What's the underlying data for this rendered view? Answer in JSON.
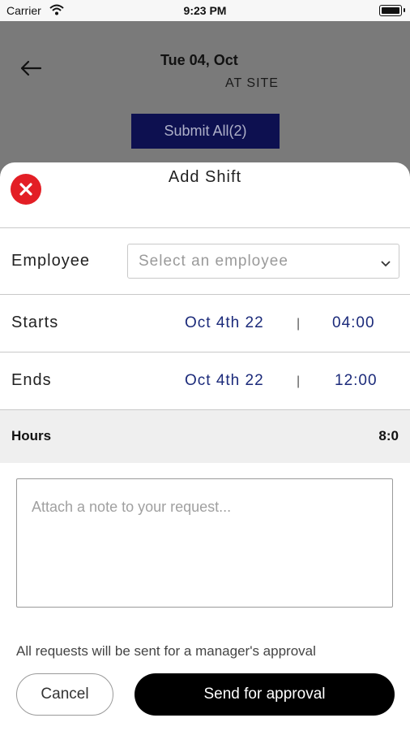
{
  "status_bar": {
    "carrier": "Carrier",
    "time": "9:23 PM"
  },
  "header": {
    "date_title": "Tue 04, Oct",
    "site_label": "AT SITE",
    "submit_all_label": "Submit All(2)"
  },
  "sheet": {
    "title": "Add Shift",
    "employee": {
      "label": "Employee",
      "placeholder": "Select an employee"
    },
    "starts": {
      "label": "Starts",
      "date": "Oct 4th 22",
      "separator": "|",
      "time": "04:00"
    },
    "ends": {
      "label": "Ends",
      "date": "Oct 4th 22",
      "separator": "|",
      "time": "12:00"
    },
    "hours": {
      "label": "Hours",
      "value": "8:0"
    },
    "note_placeholder": "Attach a note to your request...",
    "approval_note": "All requests will be sent for a manager's approval",
    "cancel_label": "Cancel",
    "send_label": "Send for approval"
  },
  "colors": {
    "submit_bg": "#0d1050",
    "close_red": "#e31e25",
    "date_blue": "#1b2a7a"
  },
  "icons": [
    "back-arrow-icon",
    "wifi-icon",
    "battery-icon",
    "close-icon",
    "chevron-down-icon"
  ]
}
